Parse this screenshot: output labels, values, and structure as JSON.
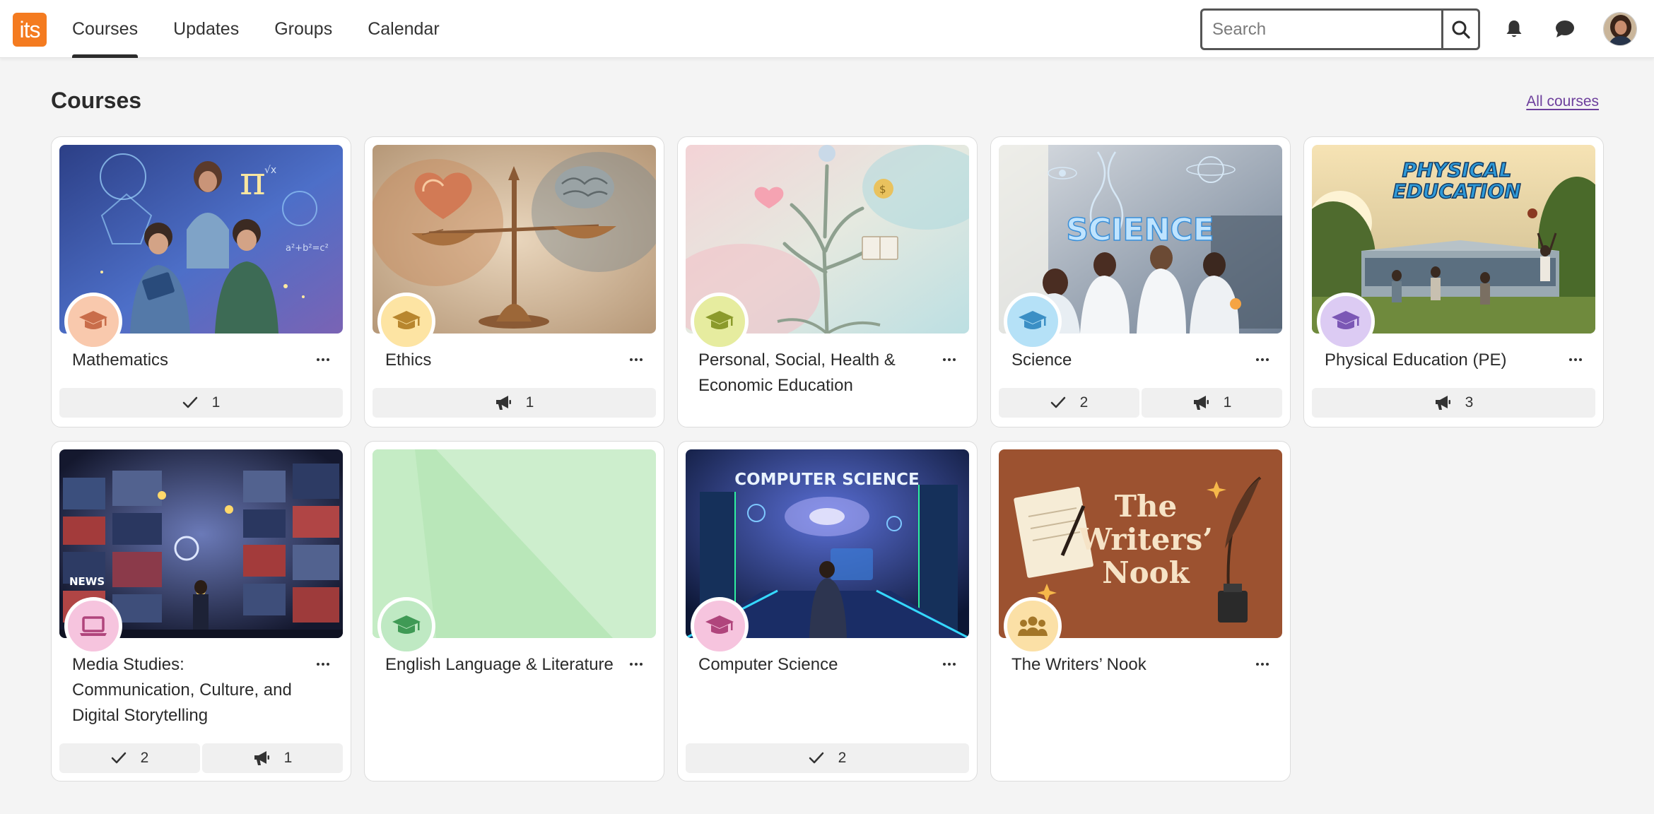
{
  "app": {
    "logo_text": "its"
  },
  "nav": [
    {
      "label": "Courses",
      "active": true
    },
    {
      "label": "Updates"
    },
    {
      "label": "Groups"
    },
    {
      "label": "Calendar"
    }
  ],
  "search": {
    "placeholder": "Search",
    "value": ""
  },
  "header": {
    "title": "Courses",
    "all_courses_label": "All courses"
  },
  "courses": [
    {
      "title": "Mathematics",
      "badge_color": "#f9c9ad",
      "badge_icon": "graduation-cap-icon",
      "stats": [
        {
          "icon": "check-icon",
          "count": "1"
        }
      ]
    },
    {
      "title": "Ethics",
      "badge_color": "#fde4a3",
      "badge_icon": "graduation-cap-icon",
      "stats": [
        {
          "icon": "megaphone-icon",
          "count": "1"
        }
      ]
    },
    {
      "title": "Personal, Social, Health & Economic Education",
      "badge_color": "#e6ec9f",
      "badge_icon": "graduation-cap-icon",
      "stats": []
    },
    {
      "title": "Science",
      "badge_color": "#b5e1f7",
      "badge_icon": "graduation-cap-icon",
      "stats": [
        {
          "icon": "check-icon",
          "count": "2"
        },
        {
          "icon": "megaphone-icon",
          "count": "1"
        }
      ]
    },
    {
      "title": "Physical Education (PE)",
      "badge_color": "#dccbf3",
      "badge_icon": "graduation-cap-icon",
      "stats": [
        {
          "icon": "megaphone-icon",
          "count": "3"
        }
      ]
    },
    {
      "title": "Media Studies: Communication, Culture, and Digital Storytelling",
      "badge_color": "#f6c4de",
      "badge_icon": "laptop-icon",
      "stats": [
        {
          "icon": "check-icon",
          "count": "2"
        },
        {
          "icon": "megaphone-icon",
          "count": "1"
        }
      ]
    },
    {
      "title": "English Language & Literature",
      "badge_color": "#bfe9c3",
      "badge_icon": "graduation-cap-icon",
      "stats": []
    },
    {
      "title": "Computer Science",
      "badge_color": "#f6c4de",
      "badge_icon": "graduation-cap-icon",
      "stats": [
        {
          "icon": "check-icon",
          "count": "2"
        }
      ]
    },
    {
      "title": "The Writers’ Nook",
      "badge_color": "#fbe0a6",
      "badge_icon": "group-icon",
      "stats": []
    }
  ],
  "thumb_text": {
    "science": "SCIENCE",
    "pe_line1": "PHYSICAL",
    "pe_line2": "EDUCATION",
    "cs": "COMPUTER SCIENCE",
    "writers_line1": "The",
    "writers_line2": "Writers’",
    "writers_line3": "Nook",
    "media_news": "NEWS"
  }
}
